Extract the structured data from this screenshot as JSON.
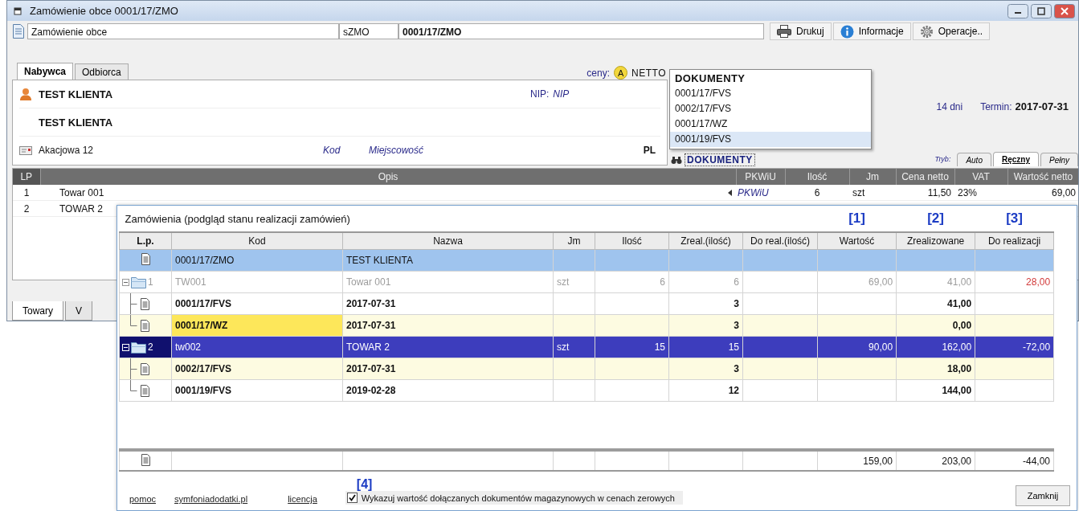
{
  "window": {
    "title": "Zamówienie obce 0001/17/ZMO"
  },
  "toolbar": {
    "document_type": "Zamówienie obce",
    "series": "sZMO",
    "number": "0001/17/ZMO",
    "buttons": [
      {
        "kind": "print",
        "label": "Drukuj"
      },
      {
        "kind": "info",
        "label": "Informacje"
      },
      {
        "kind": "gear",
        "label": "Operacje.."
      }
    ]
  },
  "party_tabs": [
    {
      "label": "Nabywca",
      "selected": true
    },
    {
      "label": "Odbiorca",
      "selected": false
    }
  ],
  "prices": {
    "label": "ceny:",
    "badge": "A",
    "mode": "NETTO"
  },
  "client": {
    "name": "TEST KLIENTA",
    "name_2": "TEST KLIENTA",
    "nip_label": "NIP:",
    "nip": "NIP",
    "street": "Akacjowa 12",
    "postcode": "Kod",
    "city": "Miejscowość",
    "country": "PL"
  },
  "payment": {
    "term": "14 dni",
    "due_label": "Termin:",
    "due_date": "2017-07-31"
  },
  "documents_link": "DOKUMENTY",
  "documents_popup": {
    "title": "DOKUMENTY",
    "items": [
      {
        "label": "0001/17/FVS",
        "selected": false
      },
      {
        "label": "0002/17/FVS",
        "selected": false
      },
      {
        "label": "0001/17/WZ",
        "selected": false
      },
      {
        "label": "0001/19/FVS",
        "selected": true
      }
    ]
  },
  "mode": {
    "label": "Tryb:",
    "tabs": [
      {
        "label": "Auto",
        "selected": false
      },
      {
        "label": "Ręczny",
        "selected": true
      },
      {
        "label": "Pełny",
        "selected": false
      }
    ]
  },
  "items": {
    "columns": [
      "LP",
      "Opis",
      "PKWiU",
      "Ilość",
      "Jm",
      "Cena netto",
      "VAT",
      "Wartość netto"
    ],
    "rows": [
      {
        "lp": "1",
        "opis": "Towar 001",
        "pkwiu": "PKWiU",
        "ilosc": "6",
        "jm": "szt",
        "cena": "11,50",
        "vat": "23%",
        "wartosc": "69,00",
        "current": true
      },
      {
        "lp": "2",
        "opis": "TOWAR 2"
      }
    ]
  },
  "bottom_tabs": [
    {
      "label": "Towary",
      "selected": true
    },
    {
      "label": "V",
      "selected": false
    }
  ],
  "dialog": {
    "title": "Zamówienia (podgląd stanu realizacji zamówień)",
    "columns": [
      {
        "label": "L.p."
      },
      {
        "label": "Kod"
      },
      {
        "label": "Nazwa"
      },
      {
        "label": "Jm"
      },
      {
        "label": "Ilość"
      },
      {
        "label": "Zreal.(ilość)"
      },
      {
        "label": "Do real.(ilość)"
      },
      {
        "label": "Wartość",
        "marker": "[1]"
      },
      {
        "label": "Zrealizowane",
        "marker": "[2]"
      },
      {
        "label": "Do realizacji",
        "marker": "[3]"
      }
    ],
    "order_row": {
      "kod": "0001/17/ZMO",
      "nazwa": "TEST KLIENTA"
    },
    "items": [
      {
        "lp": "1",
        "kod": "TW001",
        "nazwa": "Towar 001",
        "jm": "szt",
        "ilosc": "6",
        "zreal": "6",
        "wartosc": "69,00",
        "zrealizowane": "41,00",
        "do_realizacji": "28,00",
        "expanded": true,
        "selected": false,
        "alert": true,
        "children": [
          {
            "kod": "0001/17/FVS",
            "nazwa": "2017-07-31",
            "zreal": "3",
            "zrealizowane": "41,00",
            "highlighted": false,
            "kod_highlighted": false
          },
          {
            "kod": "0001/17/WZ",
            "nazwa": "2017-07-31",
            "zreal": "3",
            "zrealizowane": "0,00",
            "highlighted": true,
            "kod_highlighted": true
          }
        ]
      },
      {
        "lp": "2",
        "kod": "tw002",
        "nazwa": "TOWAR 2",
        "jm": "szt",
        "ilosc": "15",
        "zreal": "15",
        "wartosc": "90,00",
        "zrealizowane": "162,00",
        "do_realizacji": "-72,00",
        "expanded": true,
        "selected": true,
        "alert": false,
        "children": [
          {
            "kod": "0002/17/FVS",
            "nazwa": "2017-07-31",
            "zreal": "3",
            "zrealizowane": "18,00",
            "highlighted": true,
            "kod_highlighted": false
          },
          {
            "kod": "0001/19/FVS",
            "nazwa": "2019-02-28",
            "zreal": "12",
            "zrealizowane": "144,00",
            "highlighted": false,
            "kod_highlighted": false
          }
        ]
      }
    ],
    "totals": {
      "wartosc": "159,00",
      "zrealizowane": "203,00",
      "do_realizacji": "-44,00"
    },
    "links": [
      "pomoc",
      "symfoniadodatki.pl",
      "licencja"
    ],
    "checkbox": {
      "label": "Wykazuj wartość dołączanych dokumentów magazynowych w cenach zerowych",
      "checked": true,
      "marker": "[4]"
    },
    "close_button": "Zamknij"
  }
}
